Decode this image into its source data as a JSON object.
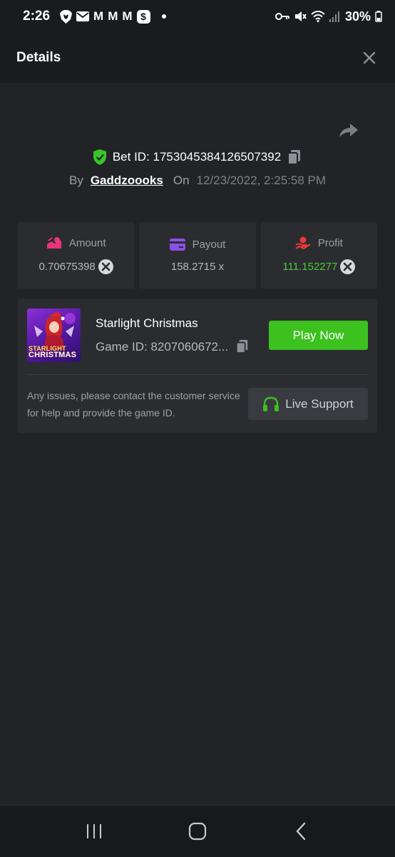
{
  "status_bar": {
    "time": "2:26",
    "m_glyph": "M",
    "dollar_glyph": "$",
    "battery": "30%",
    "icons": [
      "brave-icon",
      "mail-icon",
      "gmail-icon",
      "gmail-icon",
      "gmail-icon",
      "cash-app-icon",
      "notification-dot",
      "key-icon",
      "mute-icon",
      "wifi-icon",
      "signal-icon",
      "battery-icon"
    ]
  },
  "header": {
    "title": "Details",
    "close_icon": "close-icon"
  },
  "bet": {
    "bet_id": "Bet ID: 1753045384126507392",
    "by_label": "By",
    "username": "Gaddzoooks",
    "on_label": "On",
    "datetime": "12/23/2022, 2:25:58 PM",
    "verified_color": "#39c52a"
  },
  "stats": [
    {
      "label": "Amount",
      "value": "0.70675398",
      "icon": "amount-icon",
      "icon_color": "#e8347a"
    },
    {
      "label": "Payout",
      "value": "158.2715 x",
      "icon": "card-icon",
      "icon_color": "#8a4fe8"
    },
    {
      "label": "Profit",
      "value": "111.152277",
      "icon": "profit-icon",
      "icon_color": "#e83a3a"
    }
  ],
  "game": {
    "title": "Starlight Christmas",
    "game_id": "Game ID: 8207060672...",
    "play_label": "Play Now",
    "thumb_text_line1": "STARLIGHT",
    "thumb_text_line2": "CHRISTMAS",
    "support_text": "Any issues, please contact the customer service for help and provide the game ID.",
    "support_label": "Live Support",
    "accent": "#3cc11f"
  },
  "nav": {
    "icons": [
      "recent-apps-icon",
      "home-icon",
      "back-icon"
    ]
  }
}
